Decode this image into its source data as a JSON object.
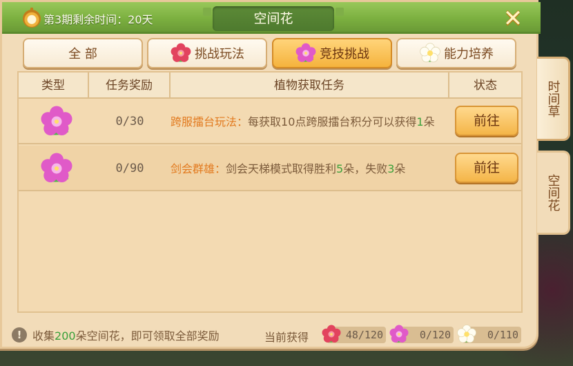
{
  "header": {
    "season_text": "第3期剩余时间：20天",
    "title": "空间花",
    "close_glyph": "✕"
  },
  "tabs": [
    {
      "label": "全 部",
      "icon": "none",
      "active": false
    },
    {
      "label": "挑战玩法",
      "icon": "red-flower-icon",
      "active": false
    },
    {
      "label": "竞技挑战",
      "icon": "pink-flower-icon",
      "active": true
    },
    {
      "label": "能力培养",
      "icon": "white-flower-icon",
      "active": false
    }
  ],
  "table": {
    "columns": [
      "类型",
      "任务奖励",
      "植物获取任务",
      "状态"
    ],
    "rows": [
      {
        "icon": "pink-flower-icon",
        "progress": "0/30",
        "task_name": "跨服擂台玩法：",
        "task_text_1": "每获取10点跨服擂台积分可以获得",
        "task_num": "1",
        "task_text_2": "朵",
        "button": "前往"
      },
      {
        "icon": "pink-flower-icon",
        "progress": "0/90",
        "task_name": "剑会群雄：",
        "task_text_1": "剑会天梯模式取得胜利",
        "task_num": "5",
        "task_text_2": "朵，失败",
        "task_num_2": "3",
        "task_text_3": "朵",
        "button": "前往"
      }
    ]
  },
  "side_tabs": [
    {
      "label": "时间草",
      "active": false
    },
    {
      "label": "空间花",
      "active": true
    }
  ],
  "footer": {
    "hint_pre": "收集",
    "hint_num": "200",
    "hint_post": "朵空间花，即可领取全部奖励",
    "current_label": "当前获得",
    "counters": [
      {
        "icon": "red-flower-icon",
        "value": "48/120"
      },
      {
        "icon": "pink-flower-icon",
        "value": "0/120"
      },
      {
        "icon": "white-flower-icon",
        "value": "0/110"
      }
    ]
  },
  "colors": {
    "title_green": "#7cb040",
    "panel_beige": "#f2dcb9",
    "active_orange": "#f5b33d",
    "highlight_orange": "#e27a1f",
    "number_green": "#3aa03a"
  }
}
